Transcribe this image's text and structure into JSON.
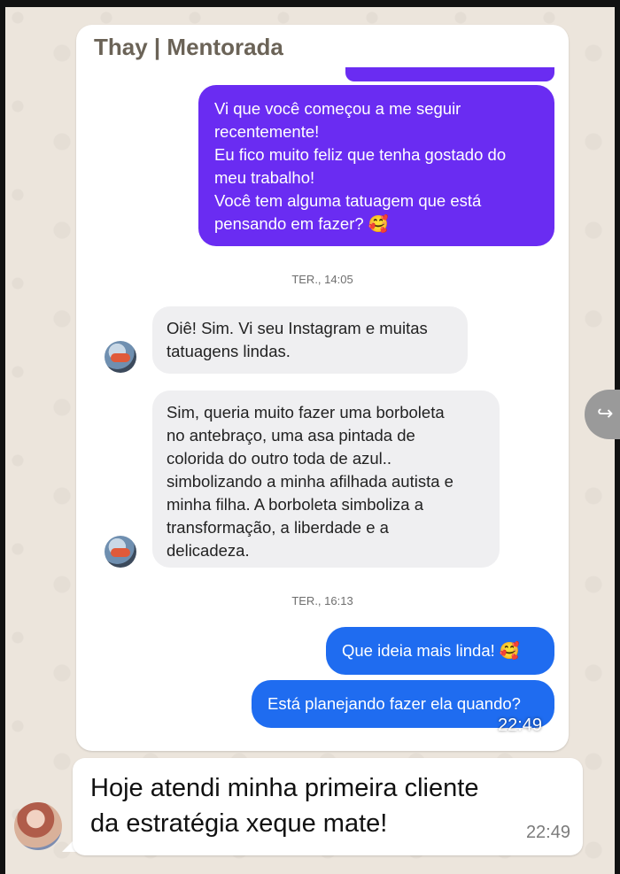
{
  "header": {
    "contact_name": "Thay | Mentorada"
  },
  "messages": {
    "out1_lines": [
      "Vi que você começou a me seguir",
      "recentemente!",
      "Eu fico muito feliz que tenha gostado do",
      "meu trabalho!",
      "Você tem alguma tatuagem que está",
      "pensando em fazer? 🥰"
    ],
    "ts1": "TER., 14:05",
    "in1_lines": [
      "Oiê! Sim. Vi seu Instagram e muitas",
      "tatuagens lindas."
    ],
    "in2_lines": [
      "Sim, queria muito fazer uma borboleta",
      "no antebraço, uma asa pintada de",
      "colorida do outro toda de azul..",
      "simbolizando a minha afilhada autista e",
      "minha filha. A borboleta simboliza a",
      "transformação, a liberdade e a",
      "delicadeza."
    ],
    "ts2": "TER., 16:13",
    "out2": "Que ideia mais linda! 🥰",
    "out3": "Está planejando fazer ela quando?",
    "overlay_time": "22:49"
  },
  "caption": {
    "text": "Hoje atendi minha primeira cliente da estratégia xeque mate!",
    "time": "22:49"
  },
  "colors": {
    "purple": "#6a2cf2",
    "blue": "#1f6cf0",
    "incoming": "#efeff1"
  },
  "icons": {
    "side_button": "share-arrow-icon"
  }
}
